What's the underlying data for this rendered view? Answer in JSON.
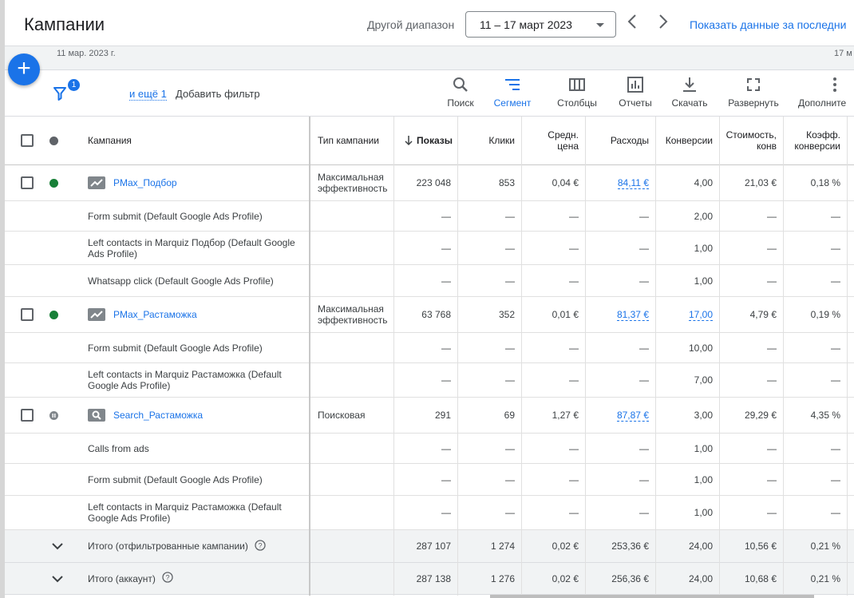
{
  "header": {
    "title": "Кампании",
    "range_label": "Другой диапазон",
    "date_range": "11 – 17 март 2023",
    "show_data": "Показать данные за последни"
  },
  "dateline": {
    "start": "11 мар. 2023 г.",
    "end": "17 м"
  },
  "fab": {
    "label": "+"
  },
  "filter": {
    "badge": "1",
    "more": "и ещё 1",
    "add": "Добавить фильтр"
  },
  "toolbar": {
    "search": "Поиск",
    "segment": "Сегмент",
    "columns": "Столбцы",
    "reports": "Отчеты",
    "download": "Скачать",
    "expand": "Развернуть",
    "more": "Дополните"
  },
  "columns": {
    "campaign": "Кампания",
    "type": "Тип кампании",
    "impressions": "Показы",
    "clicks": "Клики",
    "avg_price_1": "Средн.",
    "avg_price_2": "цена",
    "cost": "Расходы",
    "conversions": "Конверсии",
    "cost_conv_1": "Стоимость,",
    "cost_conv_2": "конв",
    "conv_rate_1": "Коэфф.",
    "conv_rate_2": "конверсии"
  },
  "rows": [
    {
      "kind": "campaign",
      "name": "PMax_Подбор",
      "type1": "Максимальная",
      "type2": "эффективность",
      "impr": "223 048",
      "clicks": "853",
      "avg": "0,04 €",
      "cost": "84,11 €",
      "conv": "4,00",
      "cpc": "21,03 €",
      "rate": "0,18 %",
      "status": "active",
      "icon": "pmax-icon"
    },
    {
      "kind": "sub",
      "name1": "Form submit (Default Google Ads Profile)",
      "name2": "",
      "impr": "—",
      "clicks": "—",
      "avg": "—",
      "cost": "—",
      "conv": "2,00",
      "cpc": "—",
      "rate": "—"
    },
    {
      "kind": "sub",
      "name1": "Left contacts in Marquiz Подбор (Default Google",
      "name2": "Ads Profile)",
      "impr": "—",
      "clicks": "—",
      "avg": "—",
      "cost": "—",
      "conv": "1,00",
      "cpc": "—",
      "rate": "—"
    },
    {
      "kind": "sub",
      "name1": "Whatsapp click (Default Google Ads Profile)",
      "name2": "",
      "impr": "—",
      "clicks": "—",
      "avg": "—",
      "cost": "—",
      "conv": "1,00",
      "cpc": "—",
      "rate": "—"
    },
    {
      "kind": "campaign",
      "name": "PMax_Растаможка",
      "type1": "Максимальная",
      "type2": "эффективность",
      "impr": "63 768",
      "clicks": "352",
      "avg": "0,01 €",
      "cost": "81,37 €",
      "conv": "17,00",
      "cpc": "4,79 €",
      "rate": "0,19 %",
      "status": "active",
      "icon": "pmax-icon",
      "conv_link": true
    },
    {
      "kind": "sub",
      "name1": "Form submit (Default Google Ads Profile)",
      "name2": "",
      "impr": "—",
      "clicks": "—",
      "avg": "—",
      "cost": "—",
      "conv": "10,00",
      "cpc": "—",
      "rate": "—"
    },
    {
      "kind": "sub",
      "name1": "Left contacts in Marquiz Растаможка (Default",
      "name2": "Google Ads Profile)",
      "impr": "—",
      "clicks": "—",
      "avg": "—",
      "cost": "—",
      "conv": "7,00",
      "cpc": "—",
      "rate": "—"
    },
    {
      "kind": "campaign",
      "name": "Search_Растаможка",
      "type1": "Поисковая",
      "type2": "",
      "impr": "291",
      "clicks": "69",
      "avg": "1,27 €",
      "cost": "87,87 €",
      "conv": "3,00",
      "cpc": "29,29 €",
      "rate": "4,35 %",
      "status": "paused",
      "icon": "search-campaign-icon"
    },
    {
      "kind": "sub",
      "name1": "Calls from ads",
      "name2": "",
      "impr": "—",
      "clicks": "—",
      "avg": "—",
      "cost": "—",
      "conv": "1,00",
      "cpc": "—",
      "rate": "—"
    },
    {
      "kind": "sub",
      "name1": "Form submit (Default Google Ads Profile)",
      "name2": "",
      "impr": "—",
      "clicks": "—",
      "avg": "—",
      "cost": "—",
      "conv": "1,00",
      "cpc": "—",
      "rate": "—"
    },
    {
      "kind": "sub",
      "name1": "Left contacts in Marquiz Растаможка (Default",
      "name2": "Google Ads Profile)",
      "impr": "—",
      "clicks": "—",
      "avg": "—",
      "cost": "—",
      "conv": "1,00",
      "cpc": "—",
      "rate": "—"
    }
  ],
  "totals": [
    {
      "label": "Итого (отфильтрованные кампании)",
      "impr": "287 107",
      "clicks": "1 274",
      "avg": "0,02 €",
      "cost": "253,36 €",
      "conv": "24,00",
      "cpc": "10,56 €",
      "rate": "0,21 %"
    },
    {
      "label": "Итого (аккаунт)",
      "impr": "287 138",
      "clicks": "1 276",
      "avg": "0,02 €",
      "cost": "256,36 €",
      "conv": "24,00",
      "cpc": "10,68 €",
      "rate": "0,21 %"
    }
  ],
  "colors": {
    "accent": "#1a73e8",
    "active": "#188038",
    "paused": "#80868b"
  }
}
